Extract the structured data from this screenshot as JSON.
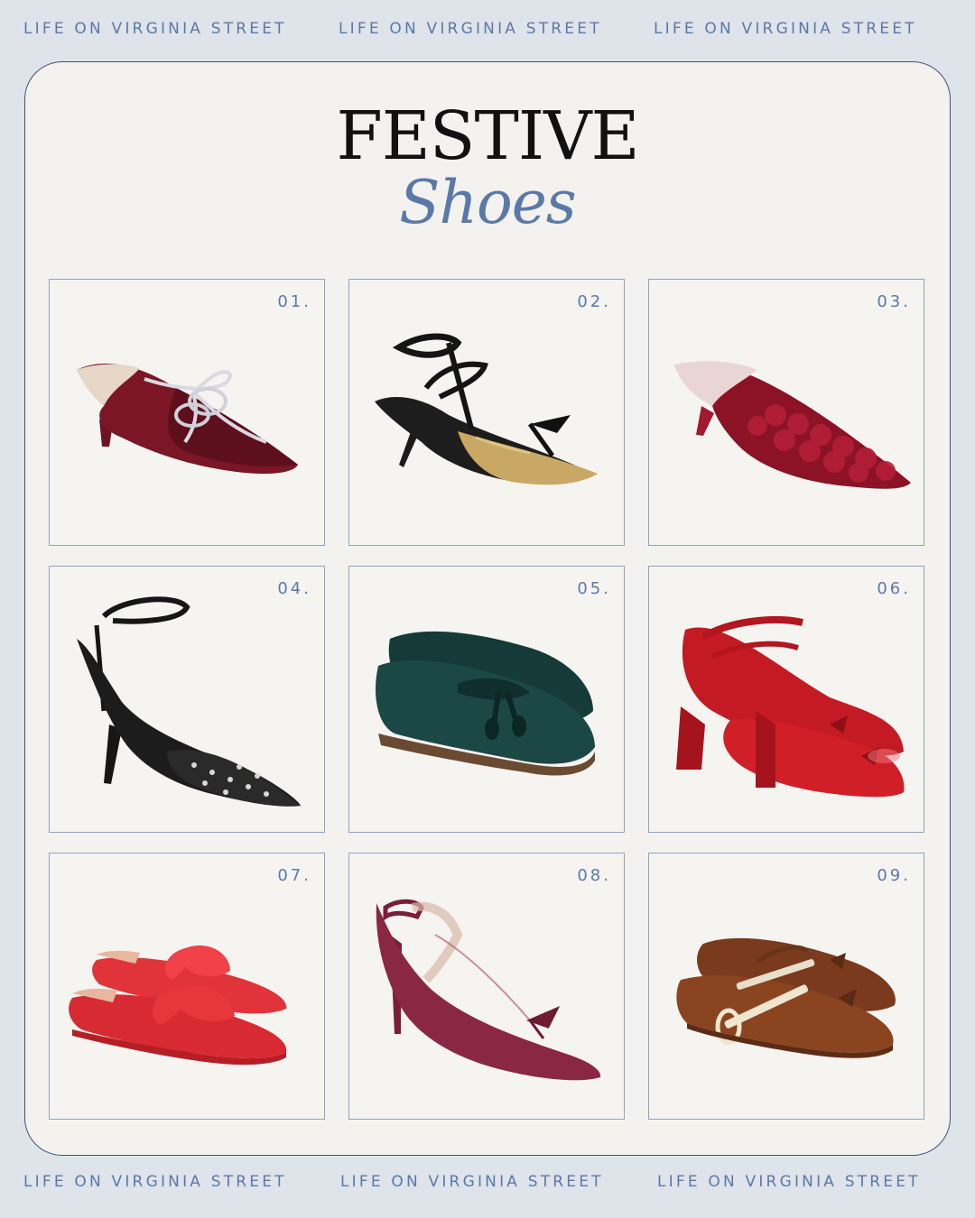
{
  "watermark": "LIFE ON VIRGINIA STREET",
  "title": "FESTIVE",
  "subtitle": "Shoes",
  "items": [
    {
      "number": "01.",
      "shoe": "burgundy velvet kitten-heel mule with crystal bow"
    },
    {
      "number": "02.",
      "shoe": "gold glitter pump with black ankle straps"
    },
    {
      "number": "03.",
      "shoe": "red sequin kitten-heel mule"
    },
    {
      "number": "04.",
      "shoe": "black beaded ankle-strap heel"
    },
    {
      "number": "05.",
      "shoe": "green velvet tassel loafer"
    },
    {
      "number": "06.",
      "shoe": "red patent block-heel mary jane"
    },
    {
      "number": "07.",
      "shoe": "red bow flat mule"
    },
    {
      "number": "08.",
      "shoe": "burgundy mesh slingback heel"
    },
    {
      "number": "09.",
      "shoe": "brown suede ballet flat with crystal strap"
    }
  ],
  "colors": {
    "background": "#dfe3ea",
    "card": "#f4f2ee",
    "accent": "#5b79a8",
    "border": "#8fa3c4"
  }
}
